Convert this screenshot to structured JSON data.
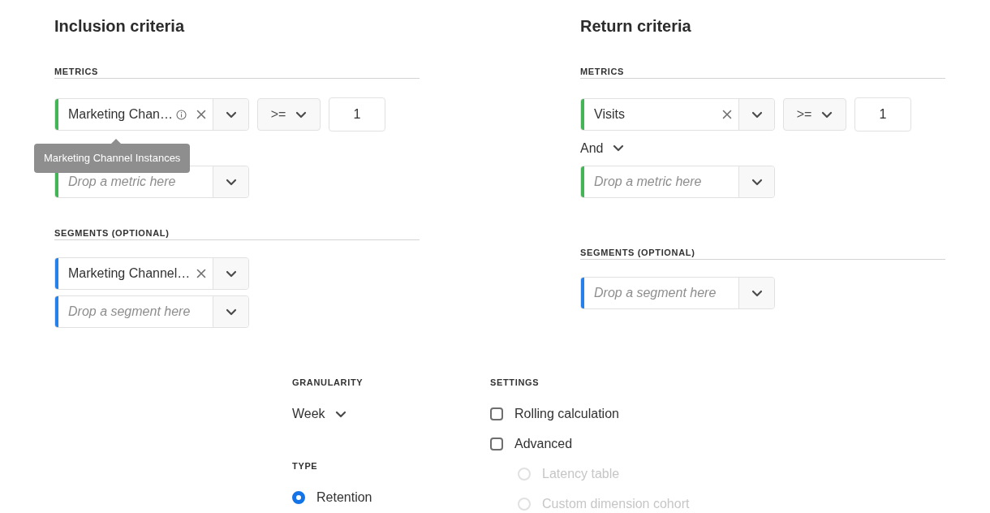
{
  "sections": [
    {
      "title": "Inclusion criteria",
      "metrics": {
        "heading": "METRICS",
        "items": [
          {
            "kind": "filled",
            "label": "Marketing Chan…",
            "info": true,
            "color": "#44b556",
            "operator": ">=",
            "value": "1",
            "tooltip": "Marketing Channel Instances"
          },
          {
            "kind": "empty",
            "placeholder": "Drop a metric here",
            "color": "#44b556"
          }
        ]
      },
      "segments": {
        "heading": "SEGMENTS (OPTIONAL)",
        "items": [
          {
            "kind": "filled",
            "label": "Marketing Channel…",
            "color": "#2680eb"
          },
          {
            "kind": "empty",
            "placeholder": "Drop a segment here",
            "color": "#2680eb"
          }
        ]
      }
    },
    {
      "title": "Return criteria",
      "metrics": {
        "heading": "METRICS",
        "conjunction": "And",
        "items": [
          {
            "kind": "filled",
            "label": "Visits",
            "color": "#44b556",
            "operator": ">=",
            "value": "1"
          },
          {
            "kind": "empty",
            "placeholder": "Drop a metric here",
            "color": "#44b556"
          }
        ]
      },
      "segments": {
        "heading": "SEGMENTS (OPTIONAL)",
        "items": [
          {
            "kind": "empty",
            "placeholder": "Drop a segment here",
            "color": "#2680eb"
          }
        ]
      }
    }
  ],
  "granularity": {
    "heading": "GRANULARITY",
    "value": "Week"
  },
  "type": {
    "heading": "TYPE",
    "options": [
      {
        "label": "Retention",
        "selected": true
      }
    ]
  },
  "settings": {
    "heading": "SETTINGS",
    "options": [
      {
        "kind": "checkbox",
        "label": "Rolling calculation",
        "checked": false
      },
      {
        "kind": "checkbox",
        "label": "Advanced",
        "checked": false
      },
      {
        "kind": "radio",
        "label": "Latency table",
        "selected": false,
        "disabled": true
      },
      {
        "kind": "radio",
        "label": "Custom dimension cohort",
        "selected": false,
        "disabled": true
      }
    ]
  }
}
